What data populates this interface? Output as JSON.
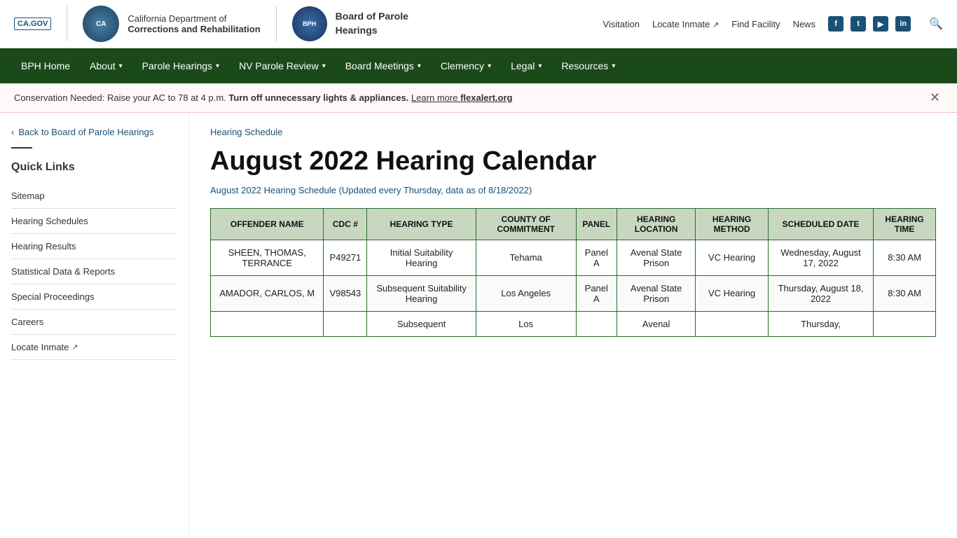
{
  "header": {
    "ca_gov_label": "CA.GOV",
    "org_name_line1": "California Department of",
    "org_name_line2": "Corrections and Rehabilitation",
    "bph_name": "Board of Parole\nHearings",
    "top_nav": {
      "visitation": "Visitation",
      "locate_inmate": "Locate Inmate",
      "find_facility": "Find Facility",
      "news": "News"
    },
    "social": {
      "facebook": "f",
      "twitter": "t",
      "youtube": "▶",
      "instagram": "in"
    }
  },
  "nav": {
    "items": [
      {
        "label": "BPH Home",
        "has_dropdown": false
      },
      {
        "label": "About",
        "has_dropdown": true
      },
      {
        "label": "Parole Hearings",
        "has_dropdown": true
      },
      {
        "label": "NV Parole Review",
        "has_dropdown": true
      },
      {
        "label": "Board Meetings",
        "has_dropdown": true
      },
      {
        "label": "Clemency",
        "has_dropdown": true
      },
      {
        "label": "Legal",
        "has_dropdown": true
      },
      {
        "label": "Resources",
        "has_dropdown": true
      }
    ]
  },
  "alert": {
    "normal_text": "Conservation Needed: Raise your AC to 78 at 4 p.m.",
    "bold_text": "Turn off unnecessary lights & appliances.",
    "link_text": "Learn more flexalert.org"
  },
  "sidebar": {
    "back_label": "Back to Board of Parole Hearings",
    "quick_links_title": "Quick Links",
    "links": [
      {
        "label": "Sitemap",
        "external": false
      },
      {
        "label": "Hearing Schedules",
        "external": false
      },
      {
        "label": "Hearing Results",
        "external": false
      },
      {
        "label": "Statistical Data & Reports",
        "external": false
      },
      {
        "label": "Special Proceedings",
        "external": false
      },
      {
        "label": "Careers",
        "external": false
      },
      {
        "label": "Locate Inmate",
        "external": true
      }
    ]
  },
  "content": {
    "breadcrumb": "Hearing Schedule",
    "page_title": "August 2022 Hearing Calendar",
    "subtitle": "August 2022 Hearing Schedule (Updated every Thursday, data as of 8/18/2022)",
    "table": {
      "headers": [
        "OFFENDER NAME",
        "CDC #",
        "HEARING TYPE",
        "COUNTY OF COMMITMENT",
        "PANEL",
        "HEARING LOCATION",
        "HEARING METHOD",
        "SCHEDULED DATE",
        "HEARING TIME"
      ],
      "rows": [
        {
          "offender_name": "SHEEN, THOMAS, TERRANCE",
          "cdc": "P49271",
          "hearing_type": "Initial Suitability Hearing",
          "county": "Tehama",
          "panel": "Panel A",
          "location": "Avenal State Prison",
          "method": "VC Hearing",
          "date": "Wednesday, August 17, 2022",
          "time": "8:30 AM"
        },
        {
          "offender_name": "AMADOR, CARLOS, M",
          "cdc": "V98543",
          "hearing_type": "Subsequent Suitability Hearing",
          "county": "Los Angeles",
          "panel": "Panel A",
          "location": "Avenal State Prison",
          "method": "VC Hearing",
          "date": "Thursday, August 18, 2022",
          "time": "8:30 AM"
        },
        {
          "offender_name": "",
          "cdc": "",
          "hearing_type": "Subsequent",
          "county": "Los",
          "panel": "",
          "location": "Avenal",
          "method": "",
          "date": "Thursday,",
          "time": ""
        }
      ]
    }
  }
}
